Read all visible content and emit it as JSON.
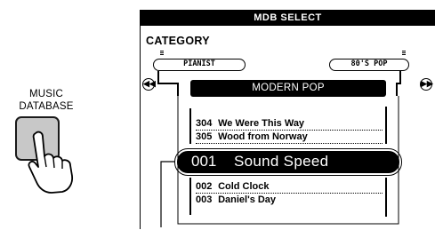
{
  "button": {
    "label_line1": "MUSIC",
    "label_line2": "DATABASE"
  },
  "screen": {
    "header": "MDB SELECT",
    "category_label": "CATEGORY",
    "category_left": "PIANIST",
    "category_right": "80'S POP",
    "current_category": "MODERN POP",
    "list_above": [
      {
        "num": "304",
        "name": "We Were This Way"
      },
      {
        "num": "305",
        "name": "Wood from Norway"
      }
    ],
    "selected": {
      "num": "001",
      "name": "Sound Speed"
    },
    "list_below": [
      {
        "num": "002",
        "name": "Cold Clock"
      },
      {
        "num": "003",
        "name": "Daniel's Day"
      }
    ]
  },
  "icons": {
    "left_arrow": "rewind-icon",
    "right_arrow": "fast-forward-icon",
    "hand": "pointing-hand-icon"
  }
}
